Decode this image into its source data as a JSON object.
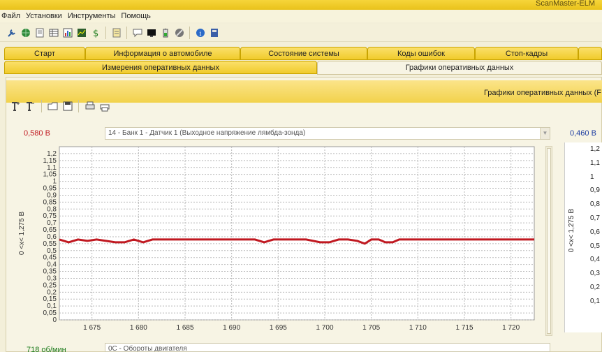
{
  "window": {
    "title": "ScanMaster-ELM"
  },
  "menu": [
    "Файл",
    "Установки",
    "Инструменты",
    "Помощь"
  ],
  "toolbar_icons": [
    "wrench-icon",
    "globe-icon",
    "document-icon",
    "table-icon",
    "bar-chart-icon",
    "chart-icon",
    "dollar-icon",
    "notepad-icon",
    "chat-icon",
    "monitor-icon",
    "battery-icon",
    "stop-icon",
    "info-icon",
    "book-icon"
  ],
  "tabs_row1": [
    "Старт",
    "Информация о автомобиле",
    "Состояние системы",
    "Коды ошибок",
    "Стоп-кадры"
  ],
  "tabs_row2": [
    "Измерения оперативных данных",
    "Графики оперативных данных"
  ],
  "panel": {
    "header": "Графики оперативных данных (F"
  },
  "graph1": {
    "current_value": "0,580 В",
    "sensor": "14 - Банк 1 - Датчик 1 (Выходное напряжение лямбда-зонда)",
    "y_axis_label": "0 <x< 1,275 В",
    "color": "#c01820"
  },
  "graph2": {
    "current_value": "0,460 В",
    "y_axis_label": "0 <x< 1,275 В",
    "tick_labels": [
      "1,2",
      "1,1",
      "1",
      "0,9",
      "0,8",
      "0,7",
      "0,6",
      "0,5",
      "0,4",
      "0,3",
      "0,2",
      "0,1"
    ]
  },
  "graph3": {
    "current_value": "718 об/мин",
    "sensor": "0C - Обороты двигателя"
  },
  "chart_data": {
    "type": "line",
    "xlabel": "",
    "ylabel": "0 <x< 1,275 В",
    "ylim": [
      0,
      1.25
    ],
    "xlim": [
      1671.5,
      1722.5
    ],
    "y_ticks": [
      0,
      0.05,
      0.1,
      0.15,
      0.2,
      0.25,
      0.3,
      0.35,
      0.4,
      0.45,
      0.5,
      0.55,
      0.6,
      0.65,
      0.7,
      0.75,
      0.8,
      0.85,
      0.9,
      0.95,
      1,
      1.05,
      1.1,
      1.15,
      1.2
    ],
    "y_tick_labels": [
      "0",
      "0,05",
      "0,1",
      "0,15",
      "0,2",
      "0,25",
      "0,3",
      "0,35",
      "0,4",
      "0,45",
      "0,5",
      "0,55",
      "0,6",
      "0,65",
      "0,7",
      "0,75",
      "0,8",
      "0,85",
      "0,9",
      "0,95",
      "1",
      "1,05",
      "1,1",
      "1,15",
      "1,2"
    ],
    "x_ticks": [
      1675,
      1680,
      1685,
      1690,
      1695,
      1700,
      1705,
      1710,
      1715,
      1720
    ],
    "x_tick_labels": [
      "1 675",
      "1 680",
      "1 685",
      "1 690",
      "1 695",
      "1 700",
      "1 705",
      "1 710",
      "1 715",
      "1 720"
    ],
    "grid": true,
    "series": [
      {
        "values": [
          [
            1671.5,
            0.58
          ],
          [
            1672.5,
            0.56
          ],
          [
            1673.5,
            0.58
          ],
          [
            1674.5,
            0.57
          ],
          [
            1675.5,
            0.58
          ],
          [
            1676.5,
            0.57
          ],
          [
            1677.5,
            0.56
          ],
          [
            1678.5,
            0.56
          ],
          [
            1679.5,
            0.58
          ],
          [
            1680.5,
            0.56
          ],
          [
            1681.5,
            0.58
          ],
          [
            1683,
            0.58
          ],
          [
            1685,
            0.58
          ],
          [
            1688,
            0.58
          ],
          [
            1691,
            0.58
          ],
          [
            1692.5,
            0.58
          ],
          [
            1693.5,
            0.56
          ],
          [
            1694.5,
            0.58
          ],
          [
            1696,
            0.58
          ],
          [
            1698,
            0.58
          ],
          [
            1699.5,
            0.56
          ],
          [
            1700.5,
            0.56
          ],
          [
            1701.5,
            0.58
          ],
          [
            1702.5,
            0.58
          ],
          [
            1703.5,
            0.57
          ],
          [
            1704.3,
            0.55
          ],
          [
            1705,
            0.58
          ],
          [
            1705.8,
            0.58
          ],
          [
            1706.5,
            0.56
          ],
          [
            1707.3,
            0.56
          ],
          [
            1708,
            0.58
          ],
          [
            1712,
            0.58
          ],
          [
            1716,
            0.58
          ],
          [
            1720,
            0.58
          ],
          [
            1722.5,
            0.58
          ]
        ]
      }
    ]
  }
}
